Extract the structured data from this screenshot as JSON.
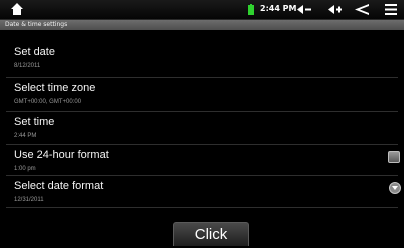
{
  "statusbar": {
    "time": "2:44 PM"
  },
  "title": "Date & time settings",
  "items": [
    {
      "title": "Set date",
      "summary": "8/12/2011"
    },
    {
      "title": "Select time zone",
      "summary": "GMT+00:00, GMT+00:00"
    },
    {
      "title": "Set time",
      "summary": "2:44 PM"
    },
    {
      "title": "Use 24-hour format",
      "summary": "1:00 pm"
    },
    {
      "title": "Select date format",
      "summary": "12/31/2011"
    }
  ],
  "button": {
    "label": "Click"
  },
  "colors": {
    "battery": "#2fd12f",
    "background": "#000000",
    "titlebar": "#5e5e5e"
  }
}
